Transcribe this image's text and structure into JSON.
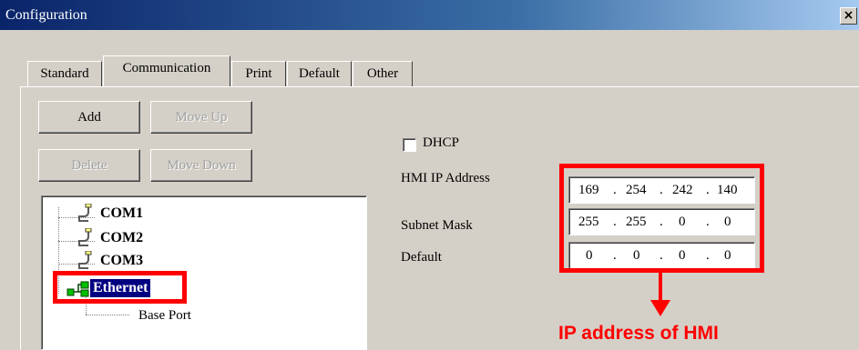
{
  "window": {
    "title": "Configuration",
    "close_label": "×"
  },
  "tabs": [
    "Standard",
    "Communication",
    "Print",
    "Default",
    "Other"
  ],
  "buttons": {
    "add": "Add",
    "move_up": "Move Up",
    "delete": "Delete",
    "move_down": "Move Down"
  },
  "tree": {
    "items": [
      "COM1",
      "COM2",
      "COM3",
      "Ethernet"
    ],
    "child": "Base Port"
  },
  "network": {
    "dhcp_label": "DHCP",
    "dhcp_checked": false,
    "ip_label": "HMI IP Address",
    "ip": [
      "169",
      "254",
      "242",
      "140"
    ],
    "mask_label": "Subnet Mask",
    "mask": [
      "255",
      "255",
      "0",
      "0"
    ],
    "gateway_label": "Default",
    "gateway": [
      "0",
      "0",
      "0",
      "0"
    ],
    "dot": "."
  },
  "annotation": {
    "text": "IP address of HMI",
    "color": "#ff0000"
  },
  "colors": {
    "titlebar": "#0a246a",
    "face": "#d4d0c8",
    "selection": "#000080"
  }
}
